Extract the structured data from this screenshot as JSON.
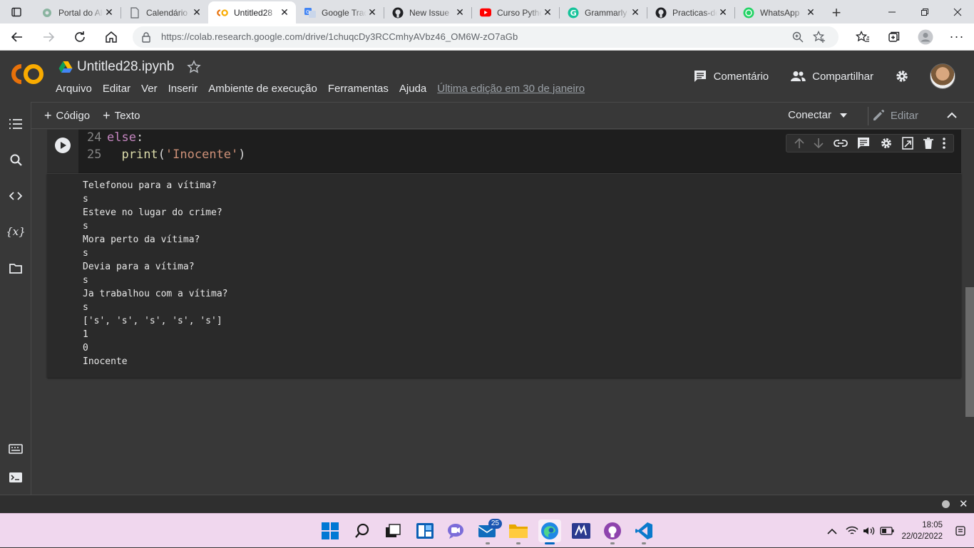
{
  "browser": {
    "tabs": [
      {
        "title": "Portal do Aluno",
        "icon": "gear-globe-icon",
        "active": false
      },
      {
        "title": "Calendário",
        "icon": "document-icon",
        "active": false
      },
      {
        "title": "Untitled28",
        "icon": "colab-icon",
        "active": true
      },
      {
        "title": "Google Tradutor",
        "icon": "google-translate-icon",
        "active": false
      },
      {
        "title": "New Issue",
        "icon": "github-icon",
        "active": false
      },
      {
        "title": "Curso Python",
        "icon": "youtube-icon",
        "active": false
      },
      {
        "title": "Grammarly",
        "icon": "grammarly-icon",
        "active": false
      },
      {
        "title": "Practicas-de",
        "icon": "github-icon",
        "active": false
      },
      {
        "title": "WhatsApp",
        "icon": "whatsapp-icon",
        "active": false
      }
    ],
    "url": "https://colab.research.google.com/drive/1chuqcDy3RCCmhyAVbz46_OM6W-zO7aGb"
  },
  "colab": {
    "doc_title": "Untitled28.ipynb",
    "menu": [
      "Arquivo",
      "Editar",
      "Ver",
      "Inserir",
      "Ambiente de execução",
      "Ferramentas",
      "Ajuda"
    ],
    "last_edit": "Última edição em 30 de janeiro",
    "comment_label": "Comentário",
    "share_label": "Compartilhar",
    "add_code_label": "Código",
    "add_text_label": "Texto",
    "connect_label": "Conectar",
    "edit_label": "Editar"
  },
  "cell": {
    "lines": [
      {
        "num": "24",
        "indent": "",
        "keyword": "else",
        "rest": ":"
      },
      {
        "num": "25",
        "indent": "  ",
        "fn": "print",
        "open": "(",
        "str": "'Inocente'",
        "close": ")"
      }
    ],
    "output": [
      "Telefonou para a vítima?",
      "s",
      "Esteve no lugar do crime?",
      "s",
      "Mora perto da vítima?",
      "s",
      "Devia para a vítima?",
      "s",
      "Ja trabalhou com a vítima?",
      "s",
      "['s', 's', 's', 's', 's']",
      "1",
      "0",
      "Inocente"
    ]
  },
  "taskbar": {
    "mail_badge": "25",
    "time": "18:05",
    "date": "22/02/2022"
  },
  "colors": {
    "colab_orange": "#f9ab00",
    "colab_orange_dark": "#e8710a",
    "taskbar_bg": "#f0d7ee",
    "accent": "#0067c0"
  }
}
